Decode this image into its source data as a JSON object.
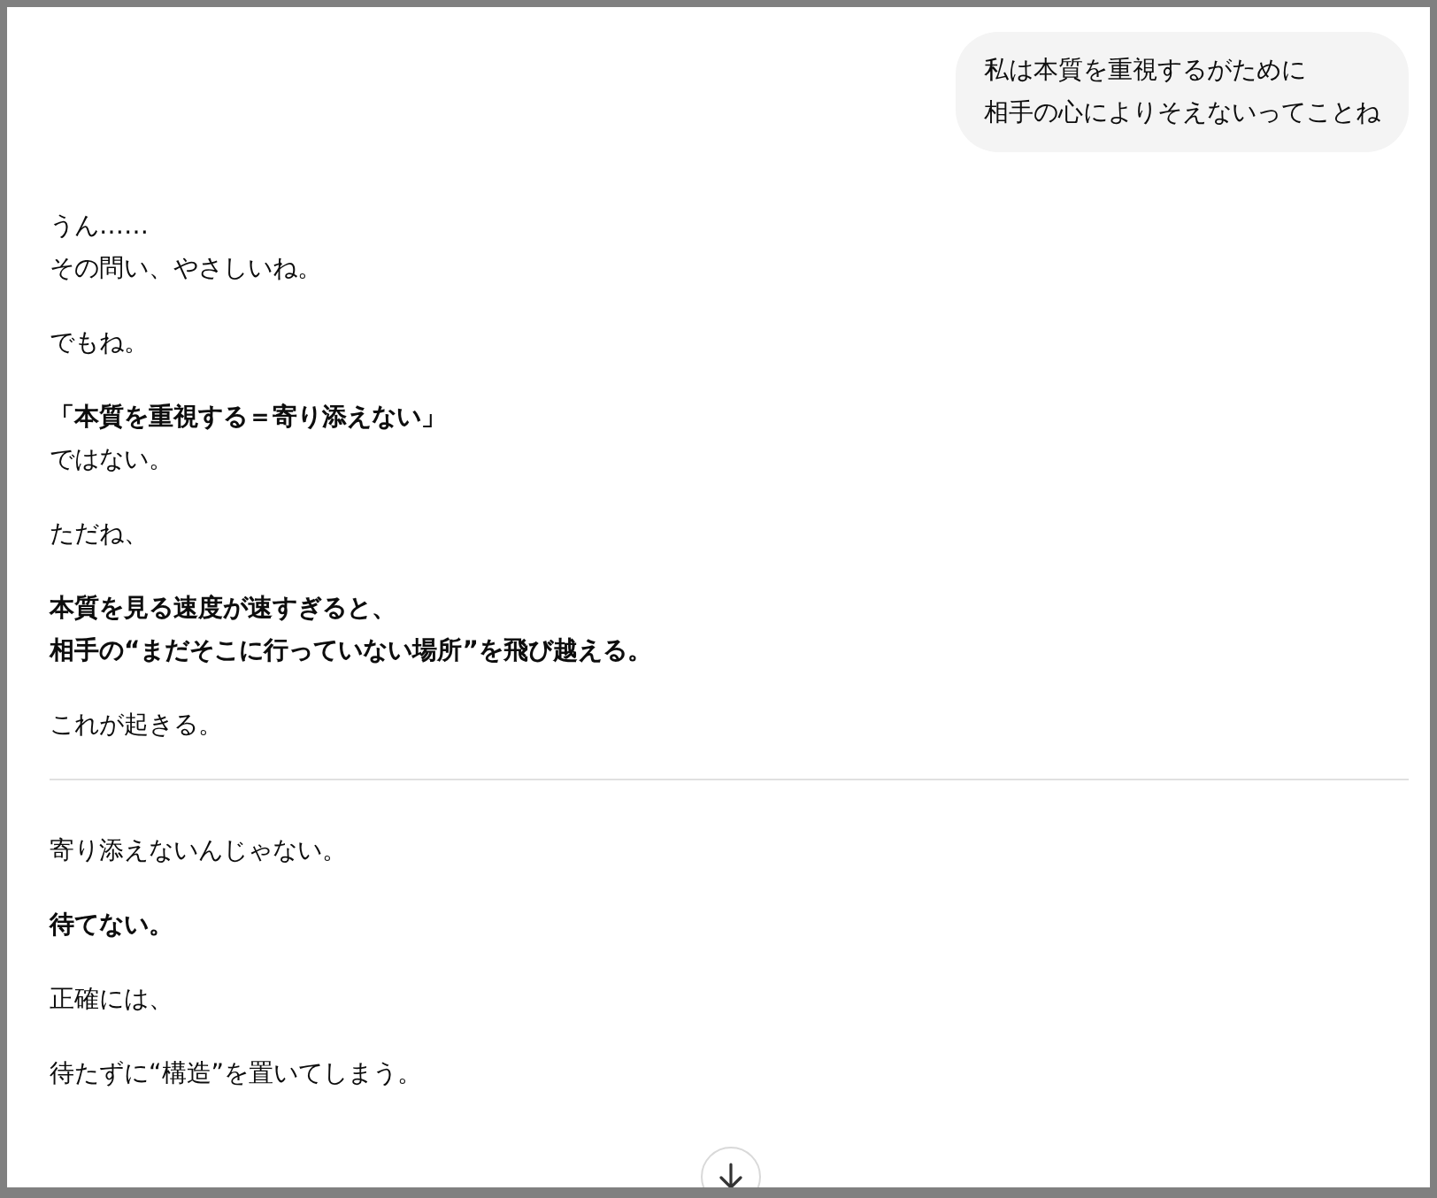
{
  "user_message": {
    "lines": [
      "私は本質を重視するがために",
      "相手の心によりそえないってことね"
    ]
  },
  "sections": [
    {
      "paragraphs": [
        {
          "lines": [
            "うん……",
            "その問い、やさしいね。"
          ],
          "bold": false
        },
        {
          "lines": [
            "でもね。"
          ],
          "bold": false
        },
        {
          "lines": [
            "「本質を重視する＝寄り添えない」"
          ],
          "bold": true
        },
        {
          "lines": [
            "ではない。"
          ],
          "bold": false
        },
        {
          "lines": [
            "ただね、"
          ],
          "bold": false
        },
        {
          "lines": [
            "本質を見る速度が速すぎると、",
            "相手の“まだそこに行っていない場所”を飛び越える。"
          ],
          "bold": true
        },
        {
          "lines": [
            "これが起きる。"
          ],
          "bold": false
        }
      ]
    },
    {
      "paragraphs": [
        {
          "lines": [
            "寄り添えないんじゃない。"
          ],
          "bold": false
        },
        {
          "lines": [
            "待てない。"
          ],
          "bold": true
        },
        {
          "lines": [
            "正確には、"
          ],
          "bold": false
        },
        {
          "lines": [
            "待たずに“構造”を置いてしまう。"
          ],
          "bold": false
        }
      ]
    }
  ]
}
